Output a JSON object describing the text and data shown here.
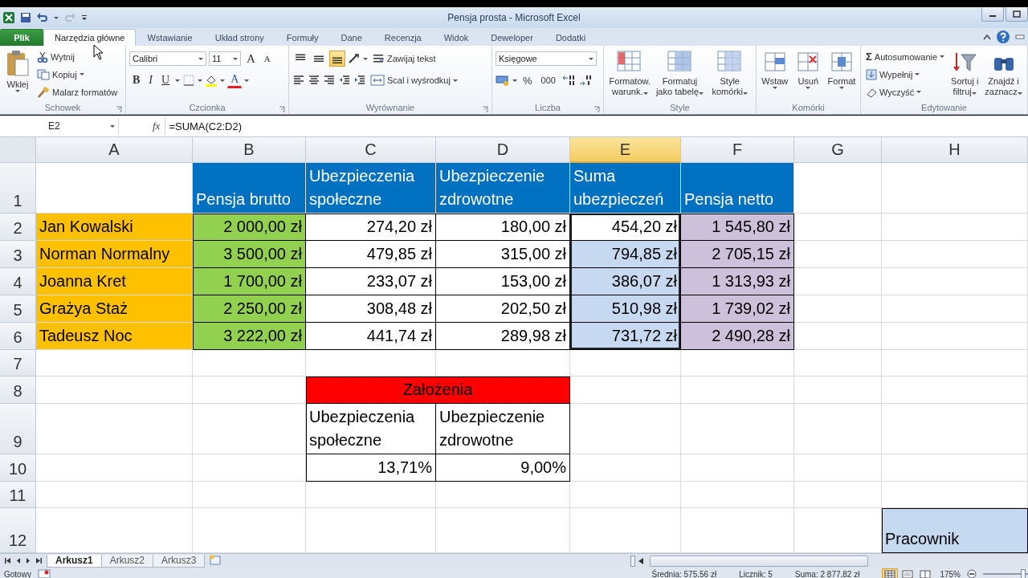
{
  "title_bar": {
    "title": "Pensja prosta - Microsoft Excel"
  },
  "ribbon_tabs": [
    {
      "label": "Plik",
      "kind": "file",
      "selected": false
    },
    {
      "label": "Narzędzia główne",
      "kind": "tab",
      "selected": true
    },
    {
      "label": "Wstawianie",
      "kind": "tab",
      "selected": false
    },
    {
      "label": "Układ strony",
      "kind": "tab",
      "selected": false
    },
    {
      "label": "Formuły",
      "kind": "tab",
      "selected": false
    },
    {
      "label": "Dane",
      "kind": "tab",
      "selected": false
    },
    {
      "label": "Recenzja",
      "kind": "tab",
      "selected": false
    },
    {
      "label": "Widok",
      "kind": "tab",
      "selected": false
    },
    {
      "label": "Deweloper",
      "kind": "tab",
      "selected": false
    },
    {
      "label": "Dodatki",
      "kind": "tab",
      "selected": false
    }
  ],
  "ribbon": {
    "clipboard": {
      "title": "Schowek",
      "paste": "Wklej",
      "cut": "Wytnij",
      "copy": "Kopiuj",
      "painter": "Malarz formatów"
    },
    "font": {
      "title": "Czcionka",
      "font_name": "Calibri",
      "font_size": "11",
      "grow": "A",
      "shrink": "A",
      "bold": "B",
      "italic": "I",
      "underline": "U",
      "font_color": "A"
    },
    "alignment": {
      "title": "Wyrównanie",
      "vertical": [
        {
          "selected": false
        },
        {
          "selected": false
        },
        {
          "selected": true
        }
      ],
      "wrap": "Zawijaj tekst",
      "merge": "Scal i wyśrodkuj"
    },
    "number": {
      "title": "Liczba",
      "format": "Księgowe",
      "percent": "%",
      "thousands": "000"
    },
    "styles": {
      "title": "Style",
      "buttons": [
        {
          "line_1": "Formatow.",
          "line_2": "warunk."
        },
        {
          "line_1": "Formatuj",
          "line_2": "jako tabelę"
        },
        {
          "line_1": "Style",
          "line_2": "komórki"
        }
      ]
    },
    "cells": {
      "title": "Komórki",
      "buttons": [
        "Wstaw",
        "Usuń",
        "Format"
      ]
    },
    "editing": {
      "title": "Edytowanie",
      "autosum_symbol": "Σ",
      "autosum": "Autosumowanie",
      "fill": "Wypełnij",
      "clear": "Wyczyść",
      "sort": [
        "Sortuj i",
        "filtruj"
      ],
      "find": [
        "Znajdź i",
        "zaznacz"
      ]
    }
  },
  "formula_bar": {
    "name_box": "E2",
    "function_symbol": "fx",
    "formula": "=SUMA(C2:D2)"
  },
  "sheet": {
    "columns": [
      {
        "label": "A",
        "selected": false
      },
      {
        "label": "B",
        "selected": false
      },
      {
        "label": "C",
        "selected": false
      },
      {
        "label": "D",
        "selected": false
      },
      {
        "label": "E",
        "selected": true
      },
      {
        "label": "F",
        "selected": false
      },
      {
        "label": "G",
        "selected": false
      },
      {
        "label": "H",
        "selected": false
      }
    ],
    "rows": [
      {
        "header": "1",
        "cells": [
          {
            "kind": "empty"
          },
          {
            "kind": "header",
            "text": "Pensja brutto",
            "color": "#0070c0",
            "bordered": false,
            "selected": false
          },
          {
            "kind": "header",
            "text": "Ubezpieczenia społeczne",
            "color": "#0070c0",
            "bordered": false,
            "selected": false
          },
          {
            "kind": "header",
            "text": "Ubezpieczenie zdrowotne",
            "color": "#0070c0",
            "bordered": false,
            "selected": false
          },
          {
            "kind": "header",
            "text": "Suma ubezpieczeń",
            "color": "#0070c0",
            "bordered": false,
            "selected": false
          },
          {
            "kind": "header",
            "text": "Pensja netto",
            "color": "#0070c0",
            "bordered": false,
            "selected": false
          },
          {
            "kind": "empty"
          },
          {
            "kind": "empty"
          }
        ]
      },
      {
        "header": "2",
        "cells": [
          {
            "kind": "label",
            "text": "Jan Kowalski",
            "color": "#ffc000",
            "bordered": false,
            "selected": false
          },
          {
            "kind": "number",
            "text": "2 000,00 zł",
            "color": "#92d050",
            "bordered": true,
            "selected": false
          },
          {
            "kind": "number",
            "text": "274,20 zł",
            "bordered": true,
            "selected": false
          },
          {
            "kind": "number",
            "text": "180,00 zł",
            "bordered": true,
            "selected": false
          },
          {
            "kind": "number",
            "text": "454,20 zł",
            "bordered": true,
            "selected": true
          },
          {
            "kind": "number",
            "text": "1 545,80 zł",
            "color": "#ccc0da",
            "bordered": true,
            "selected": false
          },
          {
            "kind": "empty"
          },
          {
            "kind": "empty"
          }
        ]
      },
      {
        "header": "3",
        "cells": [
          {
            "kind": "label",
            "text": "Norman Normalny",
            "color": "#ffc000",
            "bordered": false,
            "selected": false
          },
          {
            "kind": "number",
            "text": "3 500,00 zł",
            "color": "#92d050",
            "bordered": true,
            "selected": false
          },
          {
            "kind": "number",
            "text": "479,85 zł",
            "bordered": true,
            "selected": false
          },
          {
            "kind": "number",
            "text": "315,00 zł",
            "bordered": true,
            "selected": false
          },
          {
            "kind": "number",
            "text": "794,85 zł",
            "bordered": true,
            "selected": true
          },
          {
            "kind": "number",
            "text": "2 705,15 zł",
            "color": "#ccc0da",
            "bordered": true,
            "selected": false
          },
          {
            "kind": "empty"
          },
          {
            "kind": "empty"
          }
        ]
      },
      {
        "header": "4",
        "cells": [
          {
            "kind": "label",
            "text": "Joanna Kret",
            "color": "#ffc000",
            "bordered": false,
            "selected": false
          },
          {
            "kind": "number",
            "text": "1 700,00 zł",
            "color": "#92d050",
            "bordered": true,
            "selected": false
          },
          {
            "kind": "number",
            "text": "233,07 zł",
            "bordered": true,
            "selected": false
          },
          {
            "kind": "number",
            "text": "153,00 zł",
            "bordered": true,
            "selected": false
          },
          {
            "kind": "number",
            "text": "386,07 zł",
            "bordered": true,
            "selected": true
          },
          {
            "kind": "number",
            "text": "1 313,93 zł",
            "color": "#ccc0da",
            "bordered": true,
            "selected": false
          },
          {
            "kind": "empty"
          },
          {
            "kind": "empty"
          }
        ]
      },
      {
        "header": "5",
        "cells": [
          {
            "kind": "label",
            "text": "Grażya Staż",
            "color": "#ffc000",
            "bordered": false,
            "selected": false
          },
          {
            "kind": "number",
            "text": "2 250,00 zł",
            "color": "#92d050",
            "bordered": true,
            "selected": false
          },
          {
            "kind": "number",
            "text": "308,48 zł",
            "bordered": true,
            "selected": false
          },
          {
            "kind": "number",
            "text": "202,50 zł",
            "bordered": true,
            "selected": false
          },
          {
            "kind": "number",
            "text": "510,98 zł",
            "bordered": true,
            "selected": true
          },
          {
            "kind": "number",
            "text": "1 739,02 zł",
            "color": "#ccc0da",
            "bordered": true,
            "selected": false
          },
          {
            "kind": "empty"
          },
          {
            "kind": "empty"
          }
        ]
      },
      {
        "header": "6",
        "cells": [
          {
            "kind": "label",
            "text": "Tadeusz Noc",
            "color": "#ffc000",
            "bordered": false,
            "selected": false
          },
          {
            "kind": "number",
            "text": "3 222,00 zł",
            "color": "#92d050",
            "bordered": true,
            "selected": false
          },
          {
            "kind": "number",
            "text": "441,74 zł",
            "bordered": true,
            "selected": false
          },
          {
            "kind": "number",
            "text": "289,98 zł",
            "bordered": true,
            "selected": false
          },
          {
            "kind": "number",
            "text": "731,72 zł",
            "bordered": true,
            "selected": true
          },
          {
            "kind": "number",
            "text": "2 490,28 zł",
            "color": "#ccc0da",
            "bordered": true,
            "selected": false
          },
          {
            "kind": "empty"
          },
          {
            "kind": "empty"
          }
        ]
      },
      {
        "header": "7",
        "cells": [
          {
            "kind": "empty"
          },
          {
            "kind": "empty"
          },
          {
            "kind": "empty"
          },
          {
            "kind": "empty"
          },
          {
            "kind": "empty"
          },
          {
            "kind": "empty"
          },
          {
            "kind": "empty"
          },
          {
            "kind": "empty"
          }
        ]
      },
      {
        "header": "8",
        "cells": [
          {
            "kind": "empty"
          },
          {
            "kind": "empty"
          },
          {
            "kind": "merged",
            "text": "Założenia",
            "color": "#ff0000",
            "bordered": true,
            "selected": false
          },
          {
            "kind": "empty"
          },
          {
            "kind": "empty"
          },
          {
            "kind": "empty"
          },
          {
            "kind": "empty"
          }
        ]
      },
      {
        "header": "9",
        "cells": [
          {
            "kind": "empty"
          },
          {
            "kind": "empty"
          },
          {
            "kind": "label",
            "text": "Ubezpieczenia społeczne",
            "bordered": true,
            "selected": false
          },
          {
            "kind": "label",
            "text": "Ubezpieczenie zdrowotne",
            "bordered": true,
            "selected": false
          },
          {
            "kind": "empty"
          },
          {
            "kind": "empty"
          },
          {
            "kind": "empty"
          },
          {
            "kind": "empty"
          }
        ]
      },
      {
        "header": "10",
        "cells": [
          {
            "kind": "empty"
          },
          {
            "kind": "empty"
          },
          {
            "kind": "number",
            "text": "13,71%",
            "bordered": true,
            "selected": false
          },
          {
            "kind": "number",
            "text": "9,00%",
            "bordered": true,
            "selected": false
          },
          {
            "kind": "empty"
          },
          {
            "kind": "empty"
          },
          {
            "kind": "empty"
          },
          {
            "kind": "empty"
          }
        ]
      },
      {
        "header": "11",
        "cells": [
          {
            "kind": "empty"
          },
          {
            "kind": "empty"
          },
          {
            "kind": "empty"
          },
          {
            "kind": "empty"
          },
          {
            "kind": "empty"
          },
          {
            "kind": "empty"
          },
          {
            "kind": "empty"
          },
          {
            "kind": "empty"
          }
        ]
      },
      {
        "header": "12",
        "cells": [
          {
            "kind": "empty"
          },
          {
            "kind": "empty"
          },
          {
            "kind": "empty"
          },
          {
            "kind": "empty"
          },
          {
            "kind": "empty"
          },
          {
            "kind": "empty"
          },
          {
            "kind": "empty"
          },
          {
            "kind": "label",
            "text": "Pracownik",
            "color": "#c5d9f1",
            "bordered": true,
            "selected": false
          }
        ]
      }
    ]
  },
  "sheet_tabs": [
    {
      "label": "Arkusz1",
      "selected": true
    },
    {
      "label": "Arkusz2",
      "selected": false
    },
    {
      "label": "Arkusz3",
      "selected": false
    }
  ],
  "status_bar": {
    "mode": "Gotowy",
    "average": "Średnia: 575,56 zł",
    "count": "Licznik: 5",
    "sum": "Suma: 2 877,82 zł",
    "views": [
      {
        "selected": true
      },
      {
        "selected": false
      },
      {
        "selected": false
      }
    ],
    "zoom": "175%",
    "zoom_slider": {
      "level": 0.8
    }
  }
}
